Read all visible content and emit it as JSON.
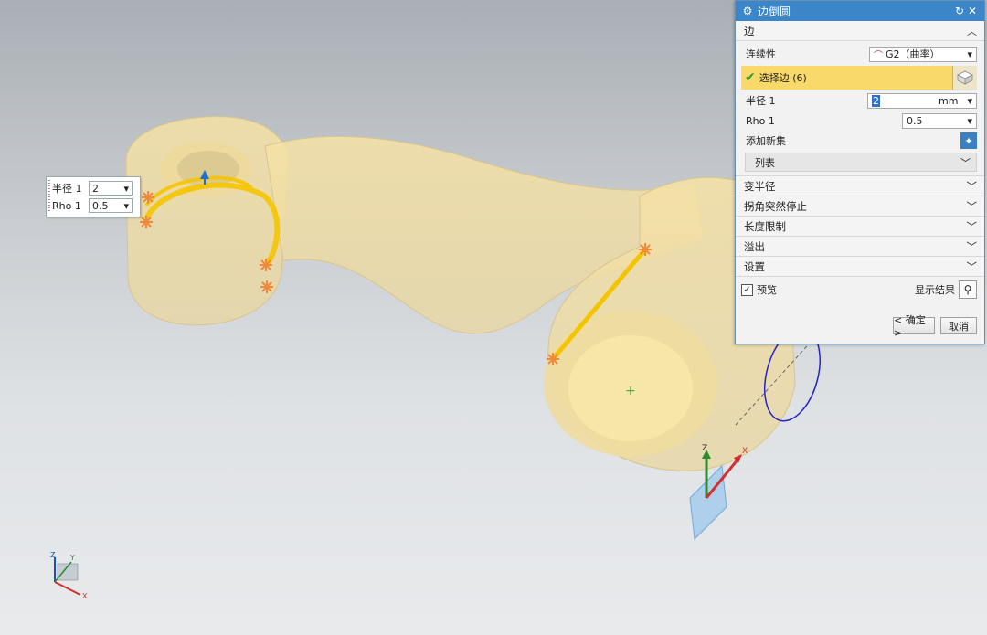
{
  "float_panel": {
    "radius_label": "半径 1",
    "radius_value": "2",
    "rho_label": "Rho 1",
    "rho_value": "0.5"
  },
  "dialog": {
    "title": "边倒圆",
    "edge_section": {
      "title": "边",
      "continuity_label": "连续性",
      "continuity_value": "G2（曲率）",
      "select_edge_label": "选择边 (6)",
      "radius_label": "半径 1",
      "radius_value": "2",
      "radius_unit": "mm",
      "rho_label": "Rho 1",
      "rho_value": "0.5",
      "add_new_set_label": "添加新集",
      "list_label": "列表"
    },
    "collapsed_sections": [
      "变半径",
      "拐角突然停止",
      "长度限制",
      "溢出",
      "设置"
    ],
    "preview_label": "预览",
    "preview_checked": true,
    "show_result_label": "显示结果",
    "ok_label": "< 确定 >",
    "cancel_label": "取消"
  },
  "triad_labels": {
    "x": "X",
    "y": "Y",
    "z": "Z"
  },
  "colors": {
    "title_bar": "#3b86c8",
    "selection_highlight": "#f9d96a",
    "part_body": "#f2dc9a",
    "edge_highlight": "#f5c400",
    "handle_marker": "#ef8a3c"
  }
}
